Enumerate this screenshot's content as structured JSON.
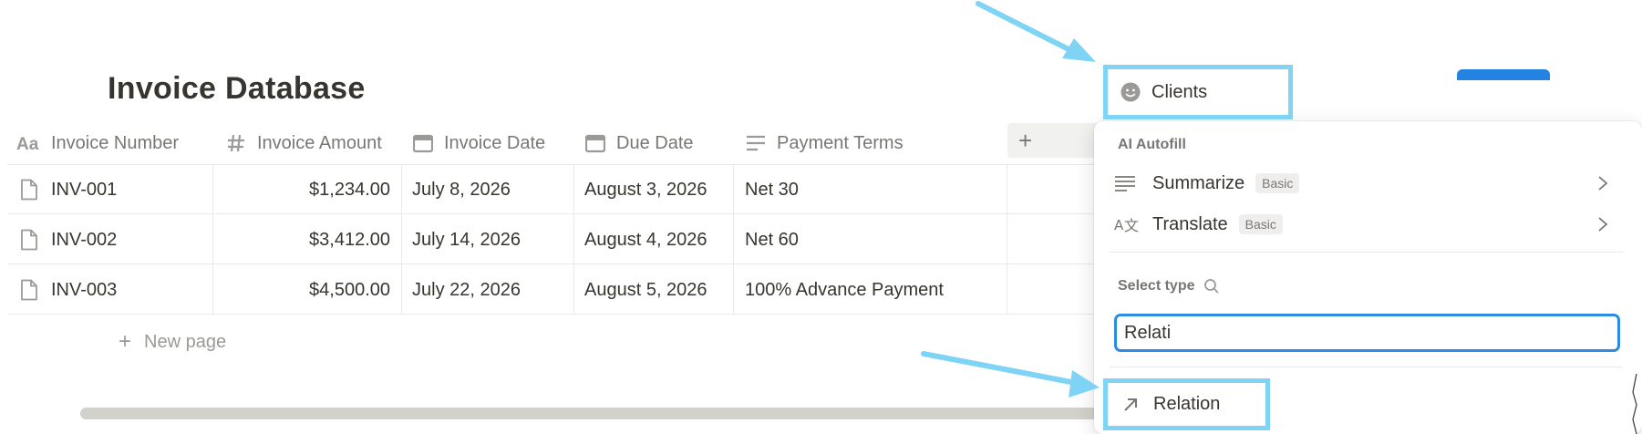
{
  "page": {
    "title": "Invoice Database"
  },
  "table": {
    "columns": [
      {
        "label": "Invoice Number",
        "icon": "title-aa-icon"
      },
      {
        "label": "Invoice Amount",
        "icon": "hash-icon"
      },
      {
        "label": "Invoice Date",
        "icon": "calendar-icon"
      },
      {
        "label": "Due Date",
        "icon": "calendar-icon"
      },
      {
        "label": "Payment Terms",
        "icon": "text-lines-icon"
      }
    ],
    "add_column": "+",
    "rows": [
      {
        "number": "INV-001",
        "amount": "$1,234.00",
        "invoice_date": "July 8, 2026",
        "due_date": "August 3, 2026",
        "terms": "Net 30"
      },
      {
        "number": "INV-002",
        "amount": "$3,412.00",
        "invoice_date": "July 14, 2026",
        "due_date": "August 4, 2026",
        "terms": "Net 60"
      },
      {
        "number": "INV-003",
        "amount": "$4,500.00",
        "invoice_date": "July 22, 2026",
        "due_date": "August 5, 2026",
        "terms": "100% Advance Payment"
      }
    ],
    "new_page": "New page"
  },
  "property_editor": {
    "name": "Clients",
    "icon": "smiley-face-icon",
    "ai_autofill_label": "AI Autofill",
    "ai_items": [
      {
        "label": "Summarize",
        "badge": "Basic",
        "icon": "summarize-lines-icon"
      },
      {
        "label": "Translate",
        "badge": "Basic",
        "icon": "translate-icon"
      }
    ],
    "select_type_label": "Select type",
    "search_value": "Relati",
    "results": [
      {
        "label": "Relation",
        "icon": "relation-arrow-icon"
      }
    ]
  },
  "colors": {
    "highlight_box": "#7fd3f5",
    "focus_border": "#2c8be3",
    "accent_blue": "#2383e2",
    "annotation_arrow": "#7fd3f5"
  }
}
